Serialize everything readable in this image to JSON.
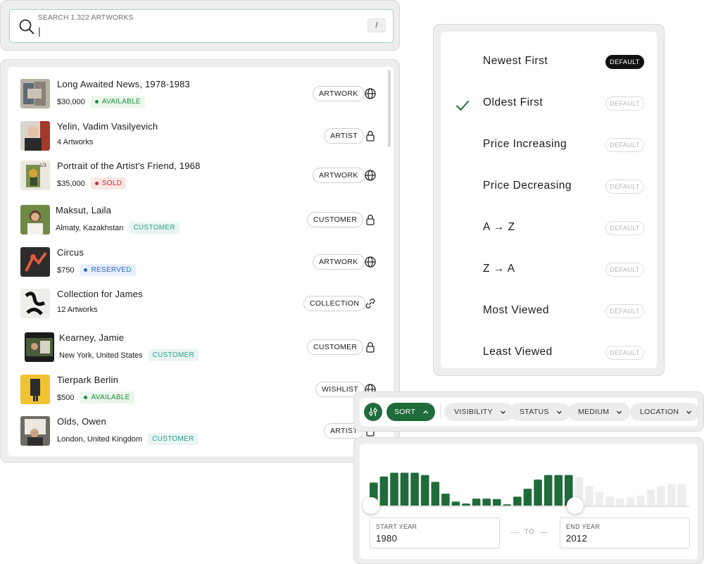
{
  "search": {
    "label": "SEARCH 1,322 ARTWORKS",
    "value": "|",
    "shortcut": "/"
  },
  "results": [
    {
      "title": "Long Awaited News, 1978-1983",
      "sub": "$30,000",
      "tag": "AVAILABLE",
      "tag_kind": "available",
      "type": "ARTWORK",
      "icon": "globe-icon"
    },
    {
      "title": "Yelin, Vadim Vasilyevich",
      "sub": "4 Artworks",
      "tag": "",
      "tag_kind": "",
      "type": "ARTIST",
      "icon": "lock-icon"
    },
    {
      "title": "Portrait of the Artist's Friend, 1968",
      "sub": "$35,000",
      "tag": "SOLD",
      "tag_kind": "sold",
      "type": "ARTWORK",
      "icon": "globe-icon",
      "thumb_badge": "1/3"
    },
    {
      "title": "Maksut, Laila",
      "sub": "Almaty, Kazakhstan",
      "tag": "CUSTOMER",
      "tag_kind": "customer",
      "type": "CUSTOMER",
      "icon": "lock-icon"
    },
    {
      "title": "Circus",
      "sub": "$750",
      "tag": "RESERVED",
      "tag_kind": "reserved",
      "type": "ARTWORK",
      "icon": "globe-icon"
    },
    {
      "title": "Collection for James",
      "sub": "12 Artworks",
      "tag": "",
      "tag_kind": "",
      "type": "COLLECTION",
      "icon": "link-icon"
    },
    {
      "title": "Kearney, Jamie",
      "sub": "New York, United States",
      "tag": "CUSTOMER",
      "tag_kind": "customer",
      "type": "CUSTOMER",
      "icon": "lock-icon"
    },
    {
      "title": "Tierpark Berlin",
      "sub": "$500",
      "tag": "AVAILABLE",
      "tag_kind": "available",
      "type": "WISHLIST",
      "icon": "globe-icon"
    },
    {
      "title": "Olds, Owen",
      "sub": "London, United Kingdom",
      "tag": "CUSTOMER",
      "tag_kind": "customer",
      "type": "ARTIST",
      "icon": "lock-icon"
    }
  ],
  "sort_menu": {
    "default_label": "DEFAULT",
    "items": [
      {
        "label": "Newest First",
        "selected": false,
        "is_default": true
      },
      {
        "label": "Oldest First",
        "selected": true,
        "is_default": false
      },
      {
        "label": "Price Increasing",
        "selected": false,
        "is_default": false
      },
      {
        "label": "Price Decreasing",
        "selected": false,
        "is_default": false
      },
      {
        "label": "A → Z",
        "selected": false,
        "is_default": false
      },
      {
        "label": "Z → A",
        "selected": false,
        "is_default": false
      },
      {
        "label": "Most Viewed",
        "selected": false,
        "is_default": false
      },
      {
        "label": "Least Viewed",
        "selected": false,
        "is_default": false
      }
    ]
  },
  "filter_bar": {
    "sort_label": "SORT",
    "filters": [
      "VISIBILITY",
      "STATUS",
      "MEDIUM",
      "LOCATION"
    ]
  },
  "year_range": {
    "start_label": "START YEAR",
    "start_value": "1980",
    "end_label": "END YEAR",
    "end_value": "2012",
    "to_label": "TO",
    "histogram": [
      0.64,
      0.8,
      0.9,
      0.9,
      0.9,
      0.84,
      0.66,
      0.35,
      0.14,
      0.09,
      0.22,
      0.22,
      0.21,
      0.07,
      0.27,
      0.48,
      0.72,
      0.84,
      0.84,
      0.84,
      0.78,
      0.55,
      0.39,
      0.27,
      0.23,
      0.25,
      0.3,
      0.45,
      0.55,
      0.6,
      0.6
    ],
    "selected_from_index": 0,
    "selected_to_index": 19,
    "selected_color": "#1f6b3a",
    "unselected_color": "#ededed"
  },
  "colors": {
    "accent_green": "#1f6b3a",
    "search_border": "#9fd4b7"
  }
}
